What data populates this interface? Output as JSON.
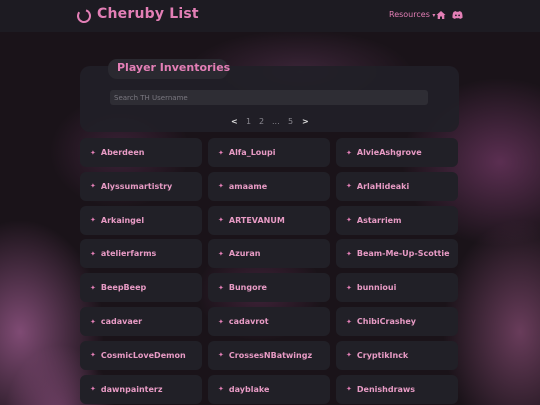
{
  "header": {
    "brand": "Cheruby List",
    "resources_label": "Resources",
    "resources_caret": "▾"
  },
  "panel": {
    "title": "Player Inventories",
    "search_placeholder": "Search TH Username"
  },
  "pagination": {
    "prev": "<",
    "pages": [
      "1",
      "2",
      "...",
      "5"
    ],
    "next": ">"
  },
  "star_glyph": "✦",
  "colors": {
    "accent": "#e37fb6",
    "card": "#212027",
    "topbar": "#1d1b22"
  },
  "users": [
    "Aberdeen",
    "Alfa_Loupi",
    "AlvieAshgrove",
    "Alyssumartistry",
    "amaame",
    "ArlaHideaki",
    "Arkaingel",
    "ARTEVANUM",
    "Astarriem",
    "atelierfarms",
    "Azuran",
    "Beam-Me-Up-Scottie",
    "BeepBeep",
    "Bungore",
    "bunnioui",
    "cadavaer",
    "cadavrot",
    "ChibiCrashey",
    "CosmicLoveDemon",
    "CrossesNBatwingz",
    "CryptikInck",
    "dawnpainterz",
    "dayblake",
    "Denishdraws"
  ]
}
